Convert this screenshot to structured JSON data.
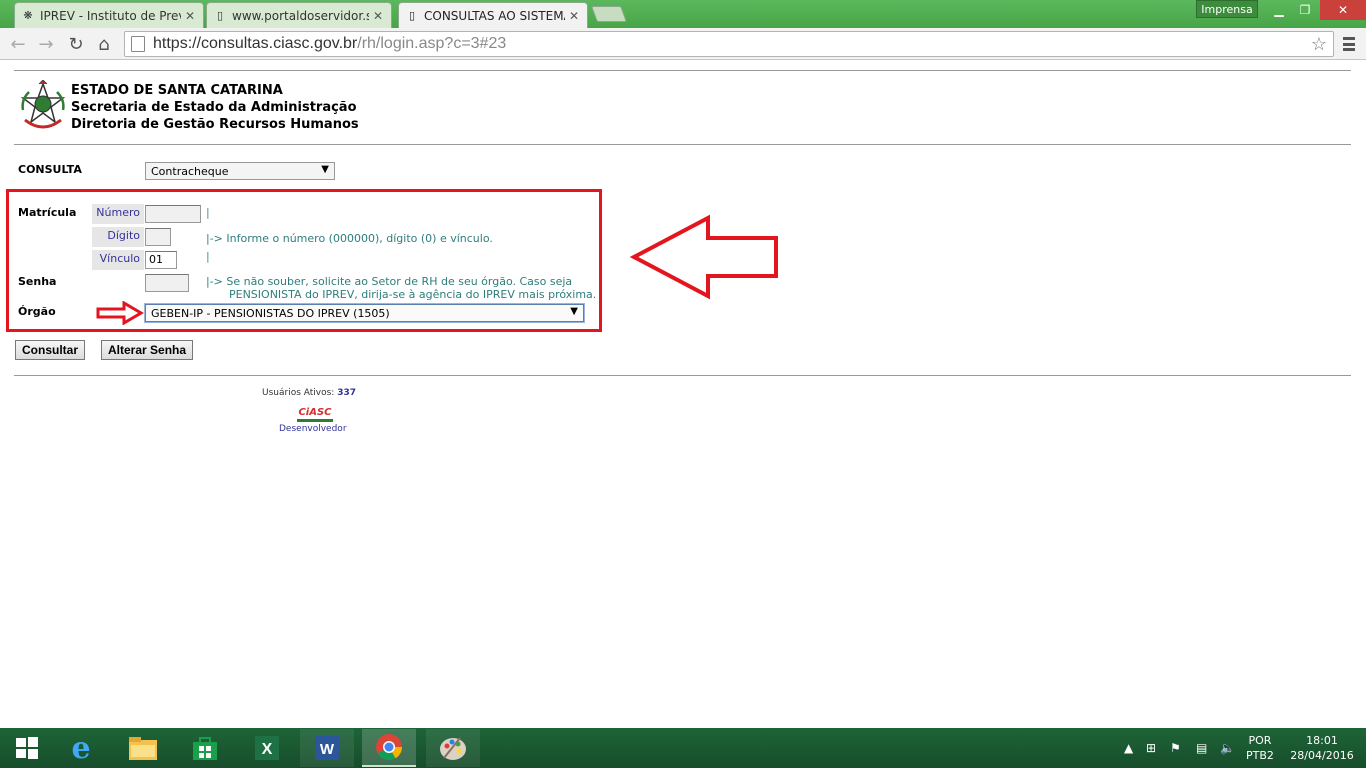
{
  "browser": {
    "tabs": [
      {
        "title": "IPREV - Instituto de Previd",
        "active": false
      },
      {
        "title": "www.portaldoservidor.sc.g",
        "active": false
      },
      {
        "title": "CONSULTAS AO SISTEMA",
        "active": true
      }
    ],
    "profile_label": "Imprensa",
    "url_host": "https://consultas.ciasc.gov.br",
    "url_path": "/rh/login.asp?c=3#23"
  },
  "header": {
    "line1": "ESTADO DE SANTA CATARINA",
    "line2": "Secretaria de Estado da Administração",
    "line3": "Diretoria de Gestão Recursos Humanos"
  },
  "form": {
    "consulta_label": "CONSULTA",
    "consulta_value": "Contracheque",
    "matricula_label": "Matrícula",
    "numero_label": "Número",
    "numero_value": "",
    "digito_label": "Dígito",
    "digito_value": "",
    "vinculo_label": "Vínculo",
    "vinculo_value": "01",
    "pipe": "|",
    "hint_matricula": "|-> Informe o número (000000), dígito (0) e vínculo.",
    "senha_label": "Senha",
    "senha_value": "",
    "hint_senha_1": "|-> Se não souber, solicite ao Setor de RH de seu órgão. Caso seja",
    "hint_senha_2": "PENSIONISTA do IPREV, dirija-se à agência do IPREV mais próxima.",
    "orgao_label": "Órgão",
    "orgao_value": "GEBEN-IP - PENSIONISTAS DO IPREV (1505)",
    "consultar_button": "Consultar",
    "alterar_senha_button": "Alterar Senha"
  },
  "footer": {
    "usuarios_label": "Usuários Ativos:",
    "usuarios_count": "337",
    "ciasc_logo_text": "CiASC",
    "desenvolvedor": "Desenvolvedor"
  },
  "annotation_colors": {
    "highlight": "#e3151f"
  },
  "taskbar": {
    "apps": [
      "start",
      "internet-explorer",
      "file-explorer",
      "store",
      "excel",
      "word",
      "chrome",
      "paint"
    ],
    "lang_1": "POR",
    "lang_2": "PTB2",
    "time": "18:01",
    "date": "28/04/2016"
  }
}
